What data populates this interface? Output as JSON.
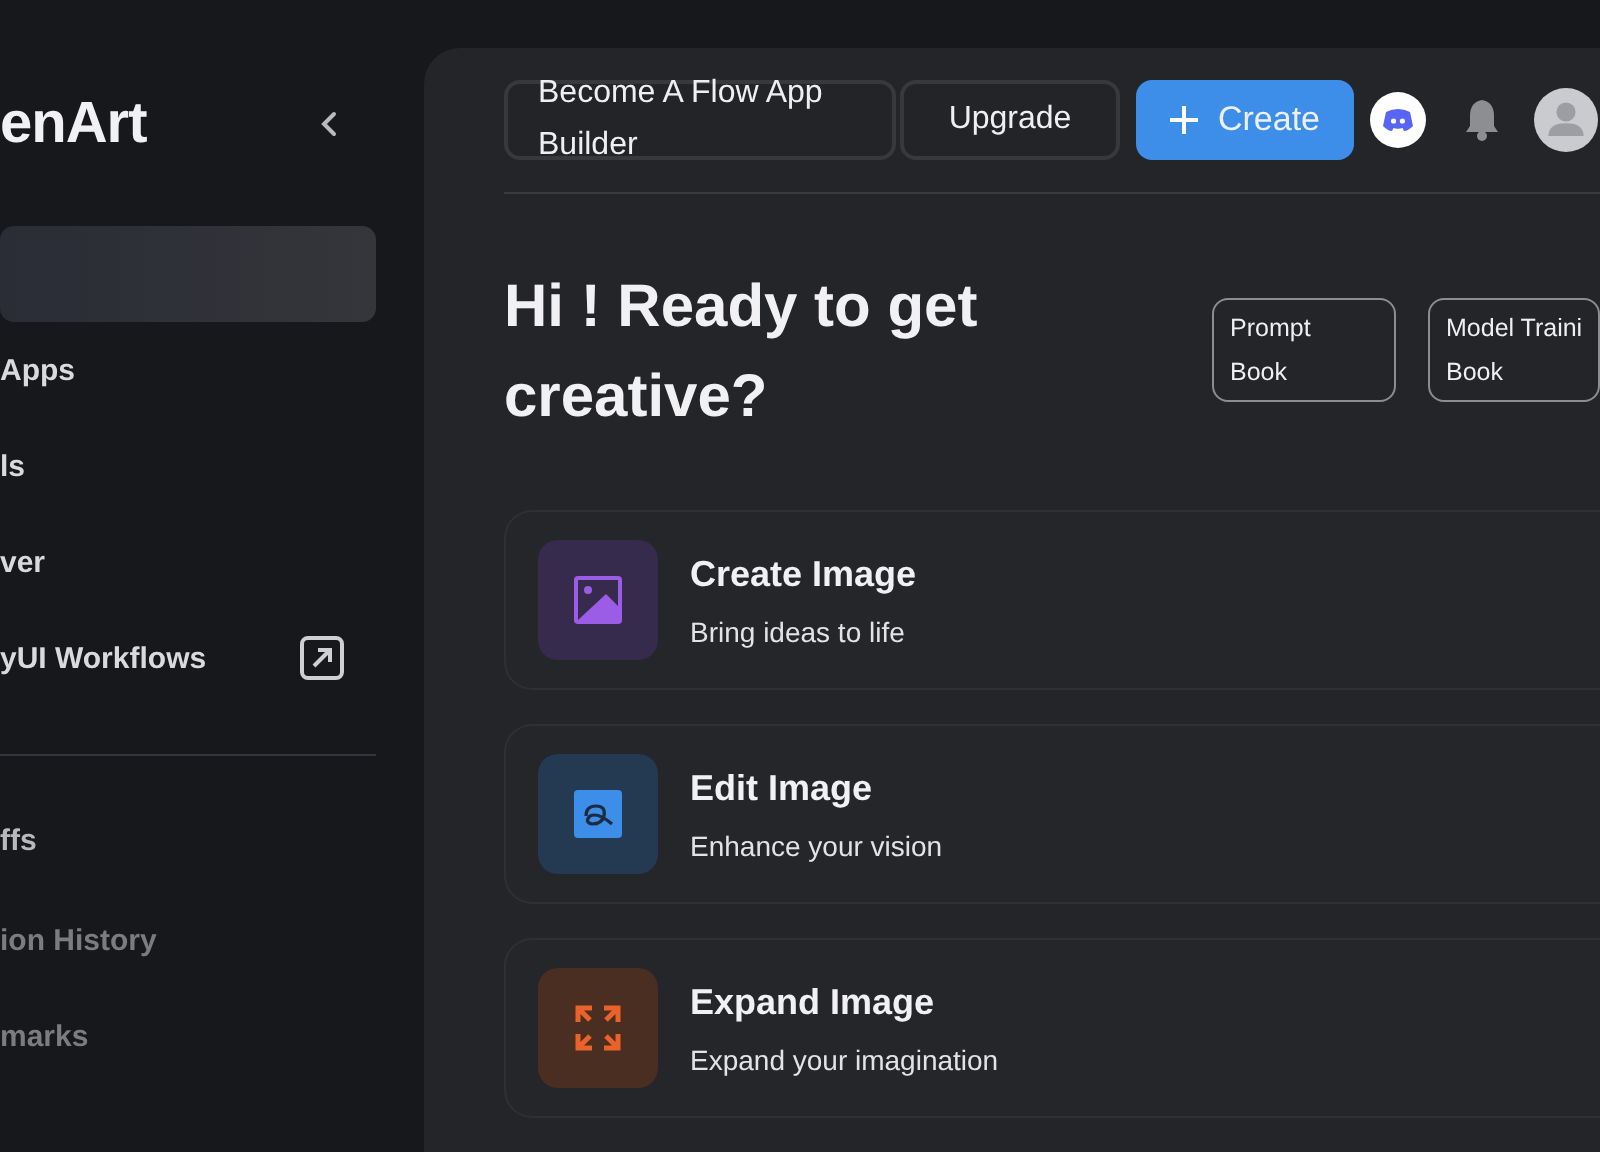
{
  "sidebar": {
    "logo": "enArt",
    "items": [
      {
        "selected": true
      },
      {
        "label": "Apps",
        "selected": false
      },
      {
        "label": "ls",
        "selected": false
      },
      {
        "label": "ver",
        "selected": false
      },
      {
        "label": "yUI Workflows",
        "selected": false,
        "external": true
      }
    ],
    "secondary_items": [
      {
        "label": "ffs",
        "dimmed": false
      },
      {
        "label": "ion History",
        "dimmed": true
      },
      {
        "label": "marks",
        "dimmed": true
      }
    ]
  },
  "top_bar": {
    "flow_button": "Become A Flow App Builder",
    "upgrade_button": "Upgrade",
    "create_button": "Create"
  },
  "hero": {
    "title": "Hi ! Ready to get creative?",
    "links": [
      "Prompt Book",
      "Model Traini Book"
    ]
  },
  "cards": [
    {
      "kind": "create",
      "title": "Create Image",
      "subtitle": "Bring ideas to life"
    },
    {
      "kind": "edit",
      "title": "Edit Image",
      "subtitle": "Enhance your vision"
    },
    {
      "kind": "expand",
      "title": "Expand Image",
      "subtitle": "Expand your imagination"
    }
  ]
}
